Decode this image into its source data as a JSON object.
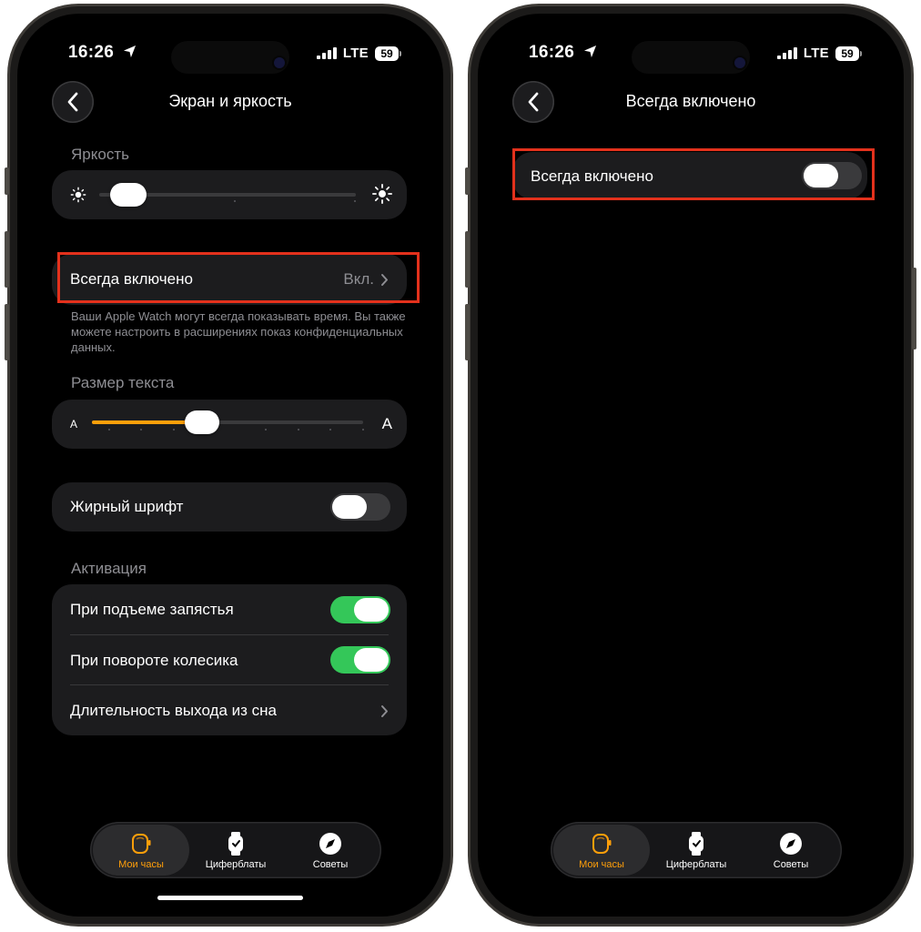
{
  "colors": {
    "accent": "#ff9f0a",
    "toggle_on": "#34c759",
    "highlight": "#e3311c"
  },
  "status": {
    "time": "16:26",
    "network": "LTE",
    "battery": "59"
  },
  "left": {
    "title": "Экран и яркость",
    "brightness_label": "Яркость",
    "brightness_level": 0.05,
    "always_on_label": "Всегда включено",
    "always_on_value": "Вкл.",
    "always_on_note": "Ваши Apple Watch могут всегда показывать время. Вы также можете настроить в расширениях показ конфиденциальных данных.",
    "text_size_label": "Размер текста",
    "text_size_small": "A",
    "text_size_large": "A",
    "text_size_level": 0.38,
    "bold_text_label": "Жирный шрифт",
    "bold_text_on": false,
    "activation_label": "Активация",
    "wrist_raise_label": "При подъеме запястья",
    "wrist_raise_on": true,
    "crown_turn_label": "При повороте колесика",
    "crown_turn_on": true,
    "wake_duration_label": "Длительность выхода из сна"
  },
  "right": {
    "title": "Всегда включено",
    "always_on_label": "Всегда включено",
    "always_on_toggle_on": false
  },
  "tabs": [
    {
      "label": "Мои часы",
      "icon": "watch-orange-icon",
      "active": true
    },
    {
      "label": "Циферблаты",
      "icon": "watch-face-icon",
      "active": false
    },
    {
      "label": "Советы",
      "icon": "compass-icon",
      "active": false
    }
  ]
}
